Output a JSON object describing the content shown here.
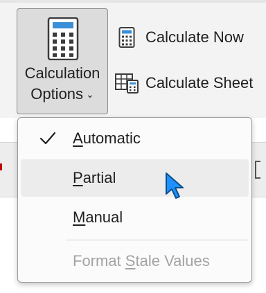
{
  "ribbon": {
    "calculation_options": {
      "label_line1": "Calculation",
      "label_line2": "Options",
      "chevron": "⌄",
      "icon": "calculator-icon"
    },
    "calculate_now": {
      "label": "Calculate Now",
      "icon": "calculator-small-icon"
    },
    "calculate_sheet": {
      "label": "Calculate Sheet",
      "icon": "sheet-calculator-icon"
    }
  },
  "menu": {
    "items": [
      {
        "accel": "A",
        "rest": "utomatic",
        "checked": true,
        "state": "normal"
      },
      {
        "accel": "P",
        "rest": "artial",
        "checked": false,
        "state": "hover"
      },
      {
        "accel": "M",
        "rest": "anual",
        "checked": false,
        "state": "normal"
      },
      {
        "before": "Format ",
        "accel": "S",
        "rest": "tale Values",
        "checked": false,
        "state": "disabled"
      }
    ]
  },
  "colors": {
    "accent": "#2b88d8",
    "cursor": "#1e90ff",
    "disabled_text": "#a3a3a3"
  }
}
